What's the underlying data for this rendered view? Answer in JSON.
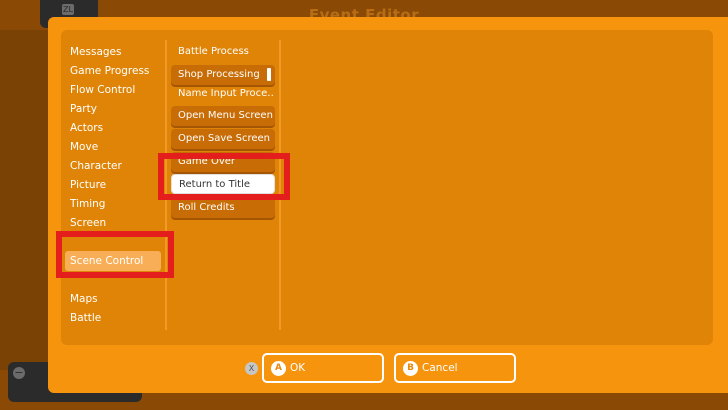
{
  "window": {
    "title": "Event Editor"
  },
  "categories": {
    "items": [
      {
        "label": "Messages"
      },
      {
        "label": "Game Progress"
      },
      {
        "label": "Flow Control"
      },
      {
        "label": "Party"
      },
      {
        "label": "Actors"
      },
      {
        "label": "Move"
      },
      {
        "label": "Character"
      },
      {
        "label": "Picture"
      },
      {
        "label": "Timing"
      },
      {
        "label": "Screen"
      },
      {
        "label": "Scene Control"
      },
      {
        "label": "Maps"
      },
      {
        "label": "Battle"
      }
    ],
    "selected": "Scene Control"
  },
  "commands": {
    "items": [
      {
        "label": "Battle Process"
      },
      {
        "label": "Shop Processing"
      },
      {
        "label": "Name Input Proce…"
      },
      {
        "label": "Open Menu Screen"
      },
      {
        "label": "Open Save Screen"
      },
      {
        "label": "Game Over"
      },
      {
        "label": "Return to Title"
      },
      {
        "label": "Roll Credits"
      }
    ],
    "selected": "Return to Title"
  },
  "footer": {
    "x_key": "X",
    "ok": {
      "key": "A",
      "label": "OK"
    },
    "cancel": {
      "key": "B",
      "label": "Cancel"
    }
  },
  "colors": {
    "modal": "#f7940d",
    "inner": "#df8406",
    "button": "#c86c05",
    "highlight": "#e41d1d"
  },
  "background": {
    "tab_glyph": "ZL",
    "minus_glyph": "−"
  }
}
